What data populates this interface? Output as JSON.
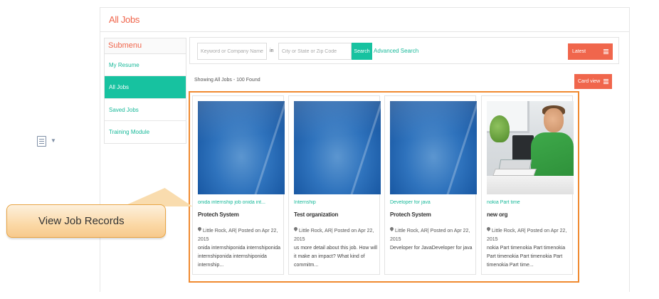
{
  "page": {
    "title": "All Jobs"
  },
  "submenu": {
    "header": "Submenu",
    "items": [
      {
        "label": "My Resume",
        "active": false
      },
      {
        "label": "All Jobs",
        "active": true
      },
      {
        "label": "Saved Jobs",
        "active": false
      },
      {
        "label": "Training Module",
        "active": false
      }
    ]
  },
  "search": {
    "keyword_placeholder": "Keyword or Company Name",
    "in_label": "in",
    "location_placeholder": "City or State or Zip Code",
    "button_label": "Search",
    "advanced_link": "Advanced Search",
    "sort_value": "Latest"
  },
  "results": {
    "count_text": "Showing All Jobs - 100 Found",
    "view_toggle": "Card view"
  },
  "jobs": [
    {
      "title": "onida internship job onida int...",
      "company": "Protech System",
      "location": "Little Rock, AR| Posted on Apr 22, 2015",
      "description": "onida internshiponida internshiponida internshiponida internshiponida internship...",
      "image": "blue-placeholder"
    },
    {
      "title": "Internship",
      "company": "Test organization",
      "location": "Little Rock, AR| Posted on Apr 22, 2015",
      "description": "us more detail about this job. How will it make an impact? What kind of commitm...",
      "image": "blue-placeholder"
    },
    {
      "title": "Developer for java",
      "company": "Protech System",
      "location": "Little Rock, AR| Posted on Apr 22, 2015",
      "description": "Developer for JavaDeveloper for java",
      "image": "blue-placeholder"
    },
    {
      "title": "nokia Part time",
      "company": "new org",
      "location": "Little Rock, AR| Posted on Apr 22, 2015",
      "description": "nokia Part timenokia Part timenokia Part timenokia Part timenokia Part timenokia Part time...",
      "image": "office-worker-photo"
    }
  ],
  "callout": {
    "text": "View Job Records"
  },
  "colors": {
    "accent": "#f0664c",
    "teal": "#17c2a0",
    "highlight": "#f08a30"
  },
  "icons": {
    "document": "document-icon",
    "pin": "map-pin-icon",
    "list": "list-icon"
  }
}
